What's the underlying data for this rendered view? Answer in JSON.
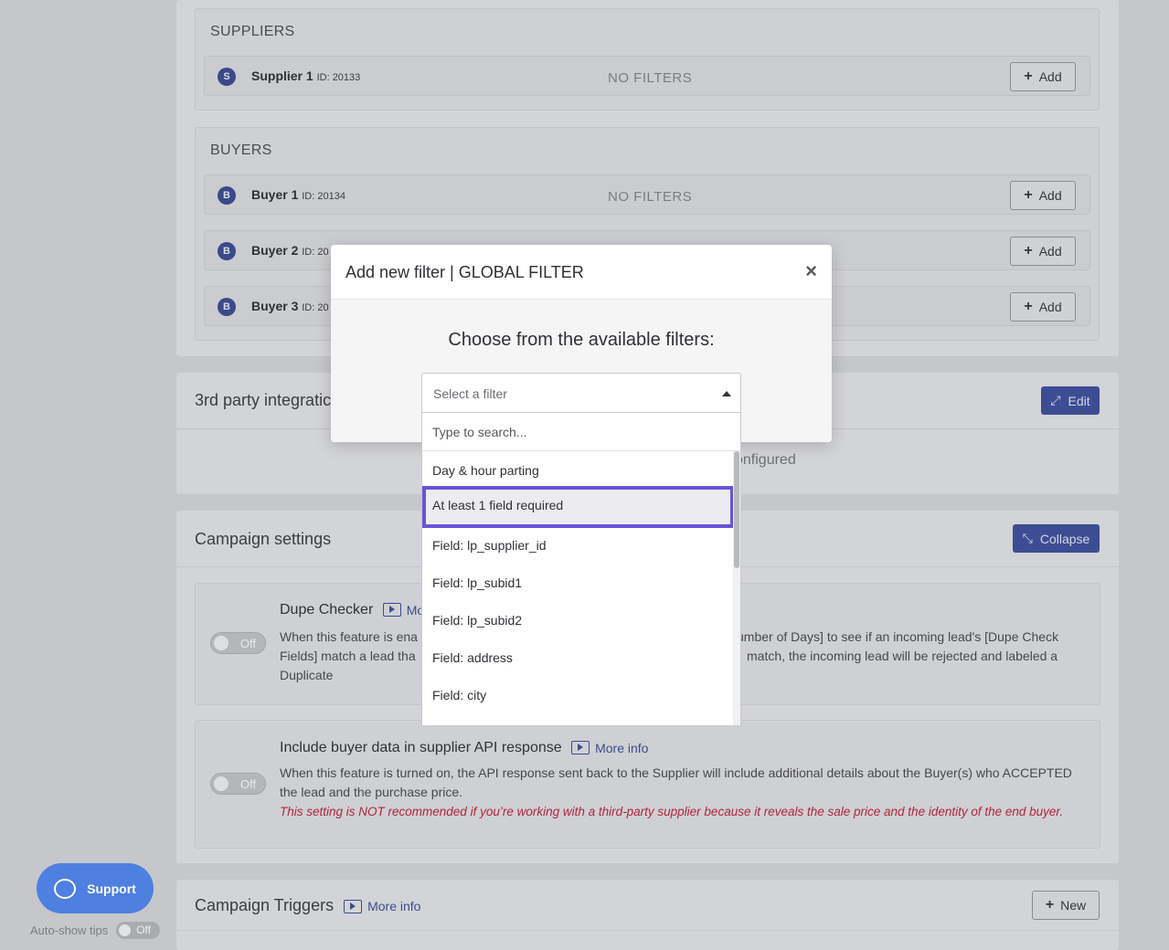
{
  "suppliers": {
    "label": "SUPPLIERS",
    "items": [
      {
        "badge": "S",
        "name": "Supplier 1",
        "id": "ID: 20133",
        "status": "NO FILTERS",
        "add_label": "Add"
      }
    ]
  },
  "buyers": {
    "label": "BUYERS",
    "items": [
      {
        "badge": "B",
        "name": "Buyer 1",
        "id": "ID: 20134",
        "status": "NO FILTERS",
        "add_label": "Add"
      },
      {
        "badge": "B",
        "name": "Buyer 2",
        "id": "ID: 20",
        "add_label": "Add"
      },
      {
        "badge": "B",
        "name": "Buyer 3",
        "id": "ID: 20",
        "add_label": "Add"
      }
    ]
  },
  "third_party": {
    "title": "3rd party integratic",
    "edit_label": "Edit",
    "status_fragment": "onfigured"
  },
  "campaign_settings": {
    "title": "Campaign settings",
    "collapse_label": "Collapse",
    "dupe": {
      "title": "Dupe Checker",
      "more": "Mo",
      "toggle": "Off",
      "line1_left": "When this feature is ena",
      "line1_right": "umber of Days] to see if an incoming lead's [Dupe Check",
      "line2_left": "Fields] match a lead tha",
      "line2_right": "match, the incoming lead will be rejected and labeled a",
      "line3": "Duplicate"
    },
    "buyer_data": {
      "title": "Include buyer data in supplier API response",
      "more": "More info",
      "toggle": "Off",
      "desc": "When this feature is turned on, the API response sent back to the Supplier will include additional details about the Buyer(s) who ACCEPTED the lead and the purchase price.",
      "warning": "This setting is NOT recommended if you’re working with a third-party supplier because it reveals the sale price and the identity of the end buyer."
    }
  },
  "triggers": {
    "title": "Campaign Triggers",
    "more": "More info",
    "new_label": "New"
  },
  "modal": {
    "title": "Add new filter | GLOBAL FILTER",
    "close": "×",
    "prompt": "Choose from the available filters:",
    "select_placeholder": "Select a filter",
    "search_placeholder": "Type to search...",
    "options": [
      "Day & hour parting",
      "At least 1 field required",
      "Field: lp_supplier_id",
      "Field: lp_subid1",
      "Field: lp_subid2",
      "Field: address",
      "Field: city"
    ],
    "highlighted_index": 1
  },
  "support": {
    "label": "Support",
    "autoshow_label": "Auto-show tips",
    "autoshow_toggle": "Off"
  }
}
